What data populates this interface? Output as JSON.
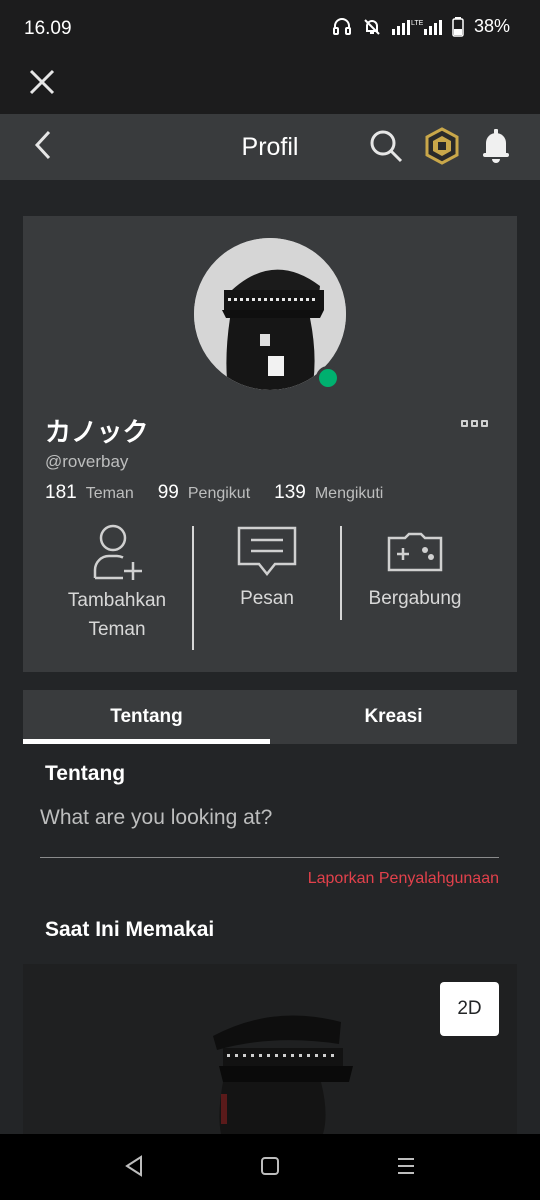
{
  "status_bar": {
    "time": "16.09",
    "battery_percent": "38%",
    "icons": [
      "headphones-icon",
      "bell-off-icon",
      "signal-lte-icon",
      "battery-icon"
    ]
  },
  "header": {
    "title": "Profil",
    "icons": [
      "back-icon",
      "search-icon",
      "robux-icon",
      "notification-bell-icon"
    ]
  },
  "profile": {
    "display_name": "カノック",
    "username": "@roverbay",
    "online": true,
    "stats": [
      {
        "value": "181",
        "label": "Teman"
      },
      {
        "value": "99",
        "label": "Pengikut"
      },
      {
        "value": "139",
        "label": "Mengikuti"
      }
    ],
    "actions": {
      "add_friend_line1": "Tambahkan",
      "add_friend_line2": "Teman",
      "message": "Pesan",
      "join": "Bergabung"
    }
  },
  "tabs": [
    {
      "label": "Tentang",
      "active": true
    },
    {
      "label": "Kreasi",
      "active": false
    }
  ],
  "about": {
    "heading": "Tentang",
    "text": "What are you looking at?",
    "report_link": "Laporkan Penyalahgunaan"
  },
  "wearing": {
    "heading": "Saat Ini Memakai",
    "view_toggle": "2D"
  },
  "colors": {
    "background": "#232527",
    "card": "#393b3d",
    "online": "#00b06f",
    "report": "#e2414b"
  }
}
